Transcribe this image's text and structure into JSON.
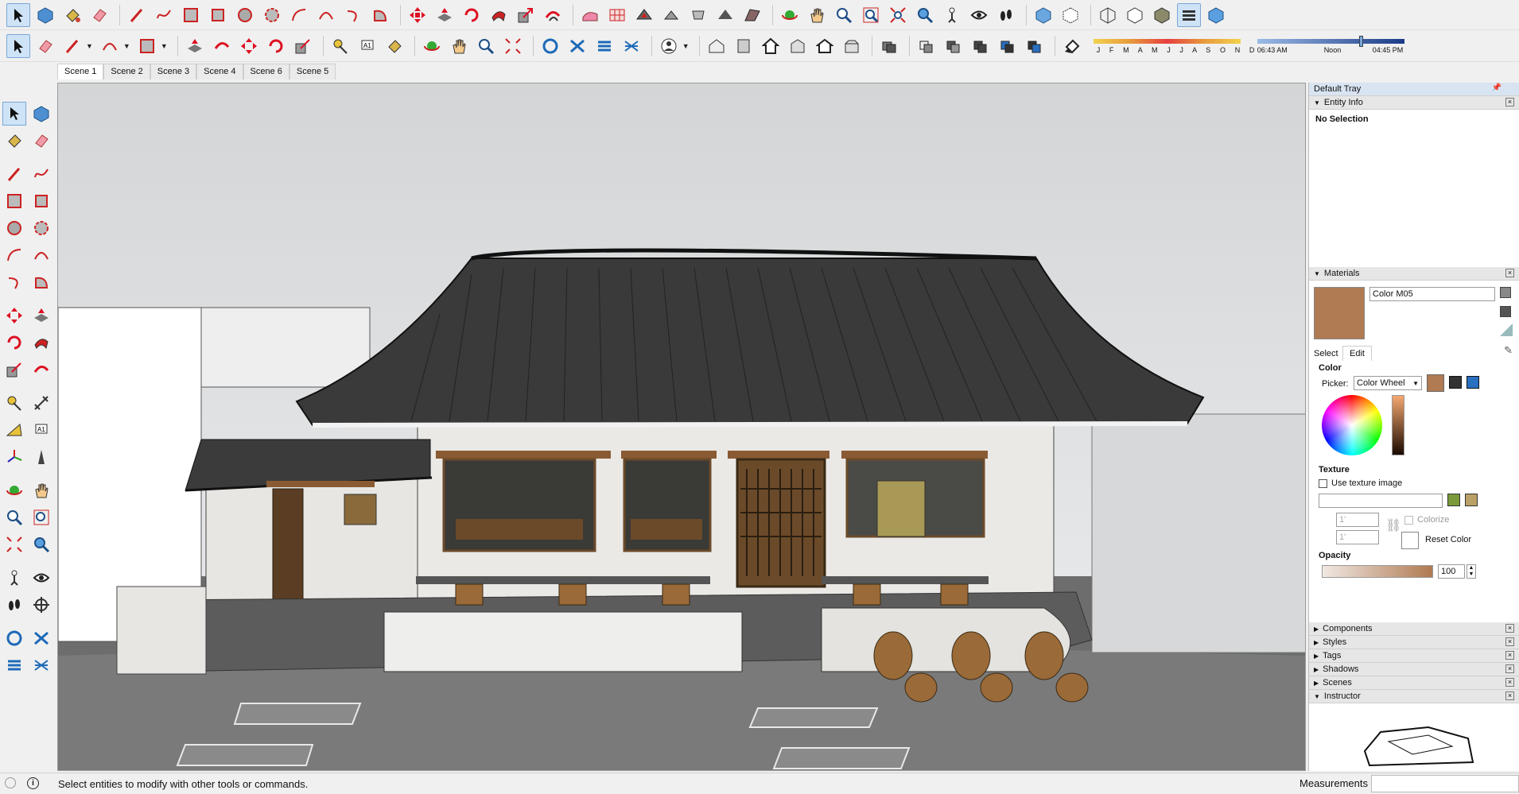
{
  "toolbar_row1": {
    "icons": [
      "select-icon",
      "component-icon",
      "paint-bucket-icon",
      "eraser-icon",
      "line-icon",
      "freehand-icon",
      "rectangle-icon",
      "rotated-rectangle-icon",
      "circle-icon",
      "polygon-icon",
      "arc-icon",
      "two-point-arc-icon",
      "three-point-arc-icon",
      "pie-icon",
      "move-icon",
      "push-pull-icon",
      "rotate-icon",
      "follow-me-icon",
      "scale-icon",
      "offset-icon",
      "sandbox-from-contours-icon",
      "sandbox-from-scratch-icon",
      "smoove-icon",
      "stamp-icon",
      "drape-icon",
      "add-detail-icon",
      "flip-edge-icon",
      "orbit-icon",
      "pan-icon",
      "zoom-icon",
      "zoom-window-icon",
      "zoom-extents-icon",
      "previous-view-icon",
      "position-camera-icon",
      "look-around-icon",
      "walk-icon",
      "xray-icon",
      "back-edges-icon",
      "wireframe-icon",
      "hidden-line-icon",
      "shaded-icon",
      "shaded-textures-icon",
      "monochrome-icon"
    ]
  },
  "toolbar_row2": {
    "icons": [
      "select-icon",
      "eraser-icon",
      "pencil-icon",
      "arc-icon",
      "rectangle-icon",
      "push-pull-icon",
      "offset-icon",
      "move-icon",
      "rotate-icon",
      "scale-icon",
      "tape-measure-icon",
      "text-icon",
      "paint-icon",
      "orbit-icon",
      "pan-icon",
      "zoom-icon",
      "zoom-extents-icon",
      "solid-tools-icon",
      "outer-shell-icon",
      "intersect-icon",
      "union-icon",
      "person-icon",
      "iso-view-icon",
      "top-view-icon",
      "front-view-icon",
      "right-view-icon",
      "back-view-icon",
      "left-view-icon",
      "group-icon",
      "outer-icon",
      "intersect-faces-icon",
      "subtract-icon",
      "trim-icon",
      "split-icon",
      "shadows-toggle-icon"
    ],
    "months": "J F M A M J J A S O N D",
    "time_start": "06:43 AM",
    "time_mid": "Noon",
    "time_end": "04:45 PM"
  },
  "scenes": [
    "Scene 1",
    "Scene 2",
    "Scene 3",
    "Scene 4",
    "Scene 5",
    "Scene 6",
    "Scene 5"
  ],
  "scenes_fixed": [
    "Scene 1",
    "Scene 2",
    "Scene 3",
    "Scene 4",
    "Scene 6",
    "Scene 5"
  ],
  "tray": {
    "title": "Default Tray",
    "entity_info": {
      "title": "Entity Info",
      "text": "No Selection"
    },
    "materials": {
      "title": "Materials",
      "name": "Color M05",
      "tab_select": "Select",
      "tab_edit": "Edit",
      "color_label": "Color",
      "picker_label": "Picker:",
      "picker_value": "Color Wheel",
      "swatch_color": "#b07a52",
      "texture_label": "Texture",
      "use_texture": "Use texture image",
      "dim1": "1'",
      "dim2": "1'",
      "colorize": "Colorize",
      "reset_color": "Reset Color",
      "opacity_label": "Opacity",
      "opacity_value": "100"
    },
    "panels": [
      "Components",
      "Styles",
      "Tags",
      "Shadows",
      "Scenes",
      "Instructor"
    ]
  },
  "status": {
    "text": "Select entities to modify with other tools or commands.",
    "measurements": "Measurements"
  }
}
